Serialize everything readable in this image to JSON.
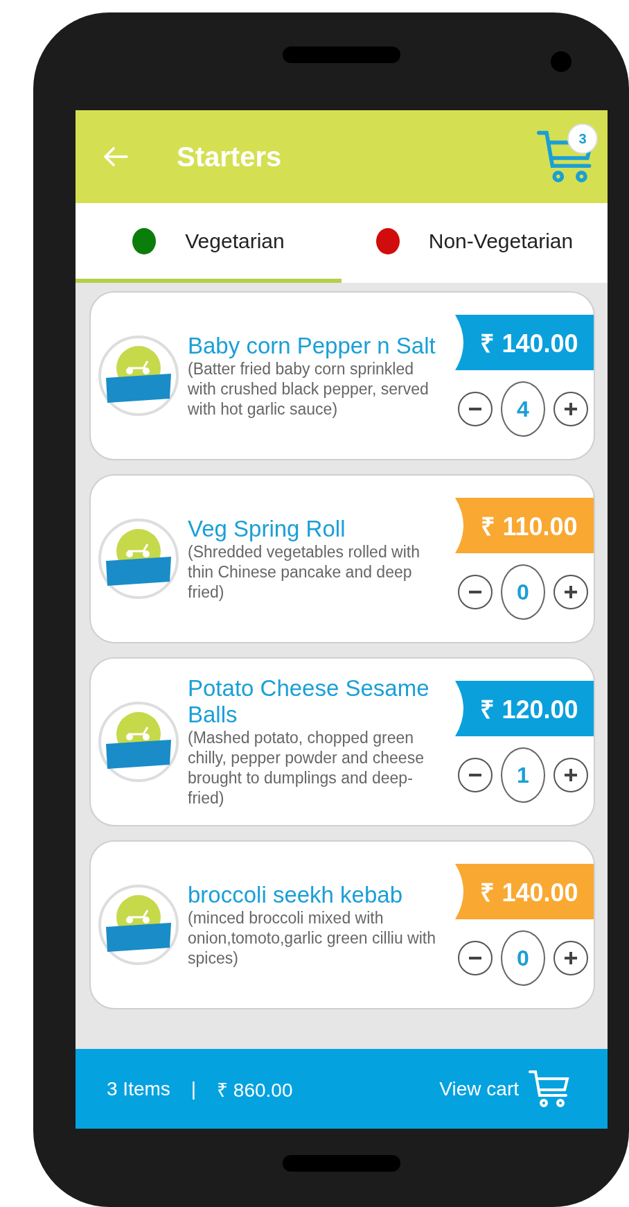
{
  "header": {
    "title": "Starters",
    "cart_count": "3"
  },
  "tabs": [
    {
      "label": "Vegetarian",
      "selected": true,
      "color": "#0a7d0a"
    },
    {
      "label": "Non-Vegetarian",
      "selected": false,
      "color": "#d10c0c"
    }
  ],
  "items": [
    {
      "name": "Baby corn Pepper n Salt",
      "description": "(Batter fried baby corn sprinkled with crushed black pepper, served with hot garlic sauce)",
      "price": "₹ 140.00",
      "color": "#0aa0dc",
      "quantity": "4"
    },
    {
      "name": "Veg Spring Roll",
      "description": "(Shredded vegetables rolled with thin Chinese pancake and deep fried)",
      "price": "₹ 110.00",
      "color": "#f9a832",
      "quantity": "0"
    },
    {
      "name": "Potato Cheese Sesame Balls",
      "description": "(Mashed potato, chopped green chilly, pepper powder and cheese brought to dumplings and deep-fried)",
      "price": "₹ 120.00",
      "color": "#0aa0dc",
      "quantity": "1"
    },
    {
      "name": "broccoli seekh kebab",
      "description": "(minced broccoli mixed with onion,tomoto,garlic green cilliu with spices)",
      "price": "₹ 140.00",
      "color": "#f9a832",
      "quantity": "0"
    }
  ],
  "footer": {
    "items": "3 Items",
    "separator": "|",
    "total": "₹ 860.00",
    "button": "View cart"
  }
}
